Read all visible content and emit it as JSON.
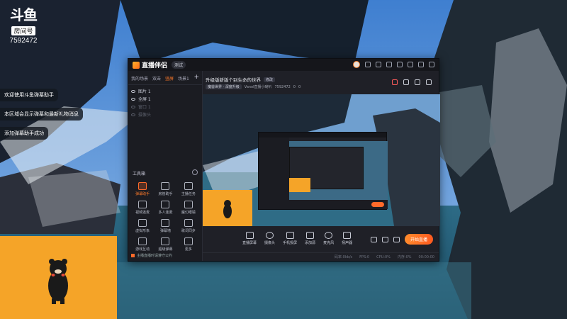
{
  "room": {
    "logo": "斗鱼",
    "label": "房间号",
    "number": "7592472"
  },
  "chat": [
    "欢迎使用斗鱼弹幕助手",
    "本区域会显示弹幕和最新礼物消息",
    "添加弹幕助手成功"
  ],
  "app": {
    "name": "直播伴侣",
    "version": "测试",
    "scene_tabs": [
      "我的场景",
      "双击",
      "竖屏",
      "场景1"
    ],
    "active_scene_index": 2,
    "sources": [
      {
        "label": "图片 1",
        "dim": false
      },
      {
        "label": "全屏 1",
        "dim": false
      },
      {
        "label": "窗口 1",
        "dim": true
      },
      {
        "label": "摄像头",
        "dim": true
      }
    ],
    "tools_title": "工具箱",
    "tools": [
      {
        "label": "弹幕助手",
        "hot": true
      },
      {
        "label": "房管助手",
        "hot": false
      },
      {
        "label": "主播任务",
        "hot": false
      },
      {
        "label": "视频连麦",
        "hot": false
      },
      {
        "label": "多人连麦",
        "hot": false
      },
      {
        "label": "魔幻眼镜",
        "hot": false
      },
      {
        "label": "虚拟形象",
        "hot": false
      },
      {
        "label": "弹幕墙",
        "hot": false
      },
      {
        "label": "歌词同步",
        "hot": false
      },
      {
        "label": "游戏互动",
        "hot": false
      },
      {
        "label": "超级弹幕",
        "hot": false
      },
      {
        "label": "更多",
        "hot": false
      }
    ],
    "left_footer": "主播直播时请遵守公约",
    "stream_title": "升级版新版个别生命的世界",
    "edit_label": "修改",
    "meta_tag": "魔兽世界 · 深度升级",
    "meta_info": "Vanol直播小喇叭",
    "meta_room": "7592472",
    "meta_likes": "0",
    "meta_fans": "0",
    "controls": [
      {
        "label": "直播屏幕",
        "round": false
      },
      {
        "label": "摄像头",
        "round": true
      },
      {
        "label": "手机投屏",
        "round": false
      },
      {
        "label": "添加源",
        "round": false
      },
      {
        "label": "麦克风",
        "round": true
      },
      {
        "label": "扬声器",
        "round": false
      }
    ],
    "go_live": "开始直播",
    "status": [
      "码率:0kb/s",
      "FPS:0",
      "CPU:0%",
      "内存:0%",
      "00:00:00"
    ]
  }
}
